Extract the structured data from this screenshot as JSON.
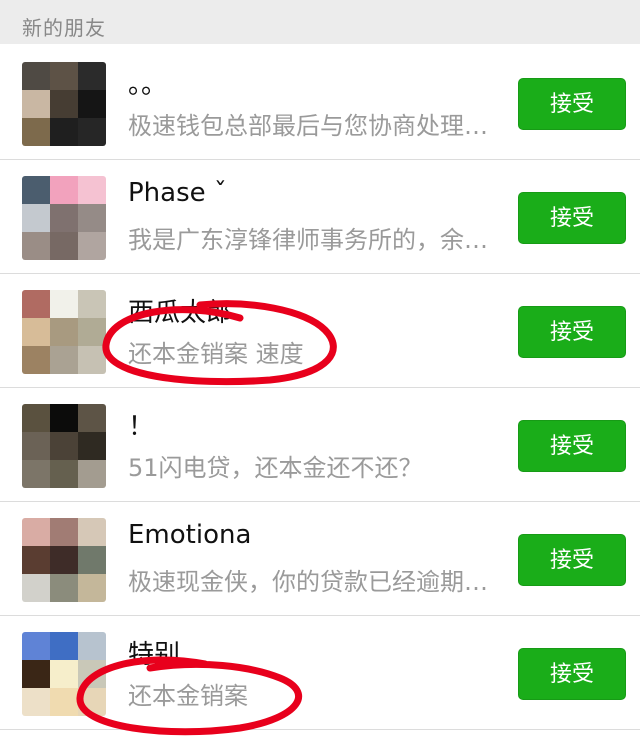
{
  "section": {
    "title": "新的朋友"
  },
  "colors": {
    "accent_green": "#1aad19",
    "annotation_red": "#e8001c"
  },
  "requests": [
    {
      "name": "。。",
      "message": "极速钱包总部最后与您协商处理…",
      "button": "接受",
      "avatar": [
        "#4f4a44",
        "#5d5246",
        "#2b2b2b",
        "#c9b7a3",
        "#463d33",
        "#151515",
        "#7d6a4c",
        "#1f1f1f",
        "#262626"
      ]
    },
    {
      "name": "Phase ˇ",
      "message": "我是广东淳锋律师事务所的，余…",
      "button": "接受",
      "avatar": [
        "#4b5d6e",
        "#f2a2bd",
        "#f5c2d2",
        "#c4c9cf",
        "#7f716f",
        "#958b87",
        "#9a8d86",
        "#776964",
        "#b0a5a0"
      ]
    },
    {
      "name": "西瓜太郎",
      "message": "还本金销案 速度",
      "button": "接受",
      "avatar": [
        "#b06b62",
        "#f1f1ea",
        "#c9c5b6",
        "#d7bc98",
        "#a89a80",
        "#b0ab95",
        "#9c8262",
        "#aaa293",
        "#c6c1b3"
      ]
    },
    {
      "name": "！",
      "message": "51闪电贷，还本金还不还？",
      "button": "接受",
      "avatar": [
        "#5a513f",
        "#0c0c0b",
        "#5d5446",
        "#6b6256",
        "#4b4237",
        "#2f2a22",
        "#7c7568",
        "#65604f",
        "#a39c90"
      ]
    },
    {
      "name": "Emotiona",
      "message": "极速现金侠，你的贷款已经逾期…",
      "button": "接受",
      "avatar": [
        "#d9aca4",
        "#a17c74",
        "#d6c8b7",
        "#5a3d31",
        "#3e2c28",
        "#70796b",
        "#d2d1cb",
        "#8b8c7c",
        "#c4b79a"
      ]
    },
    {
      "name": "特别",
      "message": "还本金销案",
      "button": "接受",
      "avatar": [
        "#5f83d6",
        "#3f6ec4",
        "#b7c3cf",
        "#3a2616",
        "#f6eecb",
        "#c9c8b8",
        "#ede0c8",
        "#f0dbb0",
        "#e7d6b7"
      ]
    }
  ]
}
